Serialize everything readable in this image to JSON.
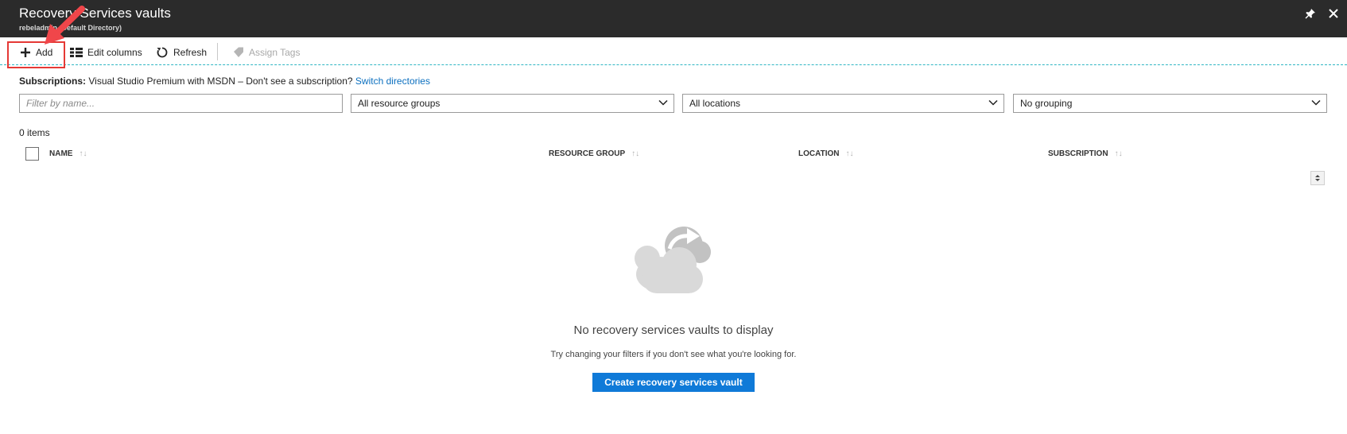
{
  "header": {
    "title": "Recovery Services vaults",
    "subtitle": "rebeladmin (Default Directory)",
    "pin_icon": "pin-icon",
    "close_icon": "close-icon"
  },
  "toolbar": {
    "add_label": "Add",
    "edit_columns_label": "Edit columns",
    "refresh_label": "Refresh",
    "assign_tags_label": "Assign Tags"
  },
  "subscriptions": {
    "label": "Subscriptions:",
    "text": "Visual Studio Premium with MSDN – Don't see a subscription?",
    "link": "Switch directories"
  },
  "filters": {
    "name_placeholder": "Filter by name...",
    "resource_groups": "All resource groups",
    "locations": "All locations",
    "grouping": "No grouping"
  },
  "items_count": "0 items",
  "table": {
    "columns": [
      "NAME",
      "RESOURCE GROUP",
      "LOCATION",
      "SUBSCRIPTION"
    ]
  },
  "empty_state": {
    "title": "No recovery services vaults to display",
    "hint": "Try changing your filters if you don't see what you're looking for.",
    "button": "Create recovery services vault"
  },
  "colors": {
    "header_bg": "#2b2b2b",
    "accent_blue": "#0f7ad8",
    "link_blue": "#0b6fbf",
    "highlight_red": "#e53935"
  }
}
